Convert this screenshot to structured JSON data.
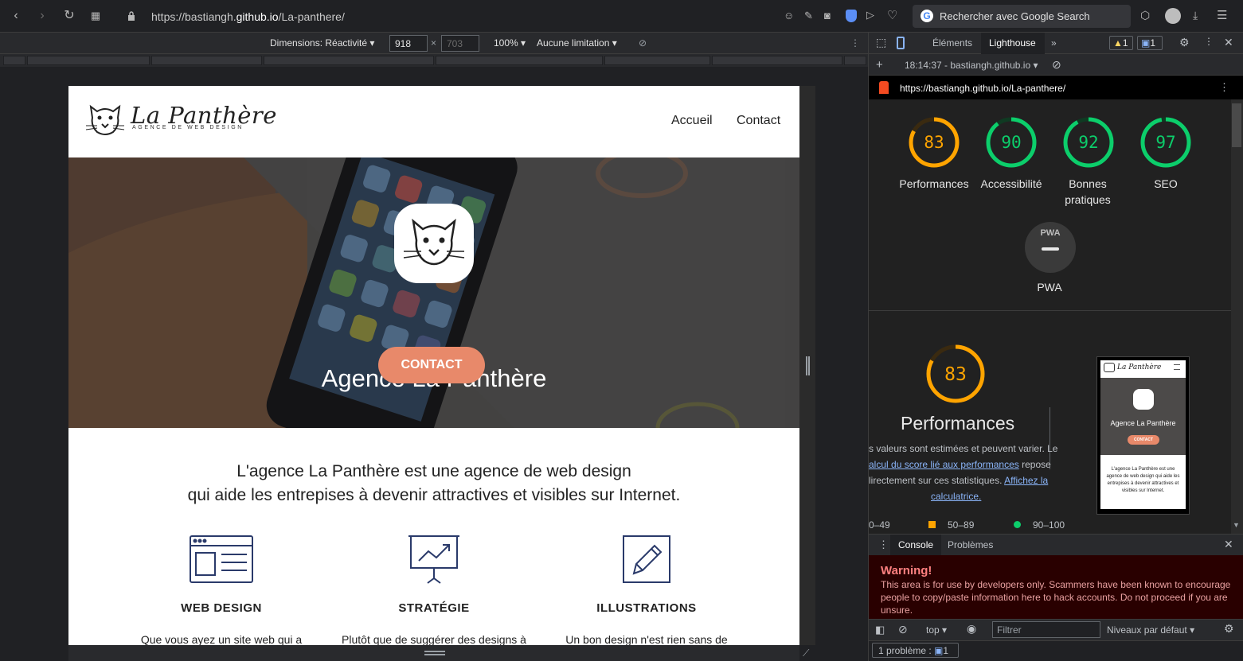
{
  "browser": {
    "url_prefix": "https://bastiangh.",
    "url_host": "github.io",
    "url_path": "/La-panthere/",
    "search_placeholder": "Rechercher avec Google Search"
  },
  "device_toolbar": {
    "dimensions_label": "Dimensions: Réactivité",
    "width": "918",
    "height": "703",
    "zoom": "100%",
    "throttling": "Aucune limitation"
  },
  "site": {
    "logo_title": "La Panthère",
    "logo_subtitle": "AGENCE DE WEB DESIGN",
    "nav": [
      "Accueil",
      "Contact"
    ],
    "hero_title": "Agence La Panthère",
    "hero_button": "CONTACT",
    "intro_line1": "L'agence La Panthère est une agence de web design",
    "intro_line2": "qui aide les entrepises à devenir attractives et visibles sur Internet.",
    "services": [
      {
        "title": "WEB DESIGN",
        "text": "Que vous ayez un site web qui a"
      },
      {
        "title": "STRATÉGIE",
        "text": "Plutôt que de suggérer des designs à"
      },
      {
        "title": "ILLUSTRATIONS",
        "text": "Un bon design n'est rien sans de"
      }
    ]
  },
  "devtools": {
    "tabs": [
      "Éléments",
      "Lighthouse"
    ],
    "warnings_count": "1",
    "messages_count": "1",
    "report_time": "18:14:37 - bastiangh.github.io",
    "report_url": "https://bastiangh.github.io/La-panthere/",
    "scores": [
      {
        "value": 83,
        "label": "Performances",
        "color": "#ffa400"
      },
      {
        "value": 90,
        "label": "Accessibilité",
        "color": "#0cce6b"
      },
      {
        "value": 92,
        "label": "Bonnes pratiques",
        "color": "#0cce6b"
      },
      {
        "value": 97,
        "label": "SEO",
        "color": "#0cce6b"
      }
    ],
    "pwa_badge": "PWA",
    "pwa_label": "PWA",
    "perf_score": 83,
    "perf_title": "Performances",
    "perf_desc_1": "s valeurs sont estimées et peuvent varier. Le",
    "perf_link_1": "alcul du score lié aux performances",
    "perf_desc_2": " repose",
    "perf_desc_3": "lirectement sur ces statistiques. ",
    "perf_link_2": "Affichez la",
    "perf_link_3": "calculatrice.",
    "legend": [
      "0–49",
      "50–89",
      "90–100"
    ],
    "thumb": {
      "logo": "La Panthère",
      "hero": "Agence La Panthère",
      "button": "CONTACT",
      "text": "L'agence La Panthère est une agence de web design qui aide les entrepises à devenir attractives et visibles sur Internet."
    }
  },
  "console": {
    "tabs": [
      "Console",
      "Problèmes"
    ],
    "warning_title": "Warning!",
    "warning_text": "This area is for use by developers only. Scammers have been known to encourage people to copy/paste information here to hack accounts. Do not proceed if you are unsure.",
    "context": "top",
    "filter_placeholder": "Filtrer",
    "levels": "Niveaux par défaut",
    "problems_label": "1 problème :",
    "problems_count": "1"
  }
}
